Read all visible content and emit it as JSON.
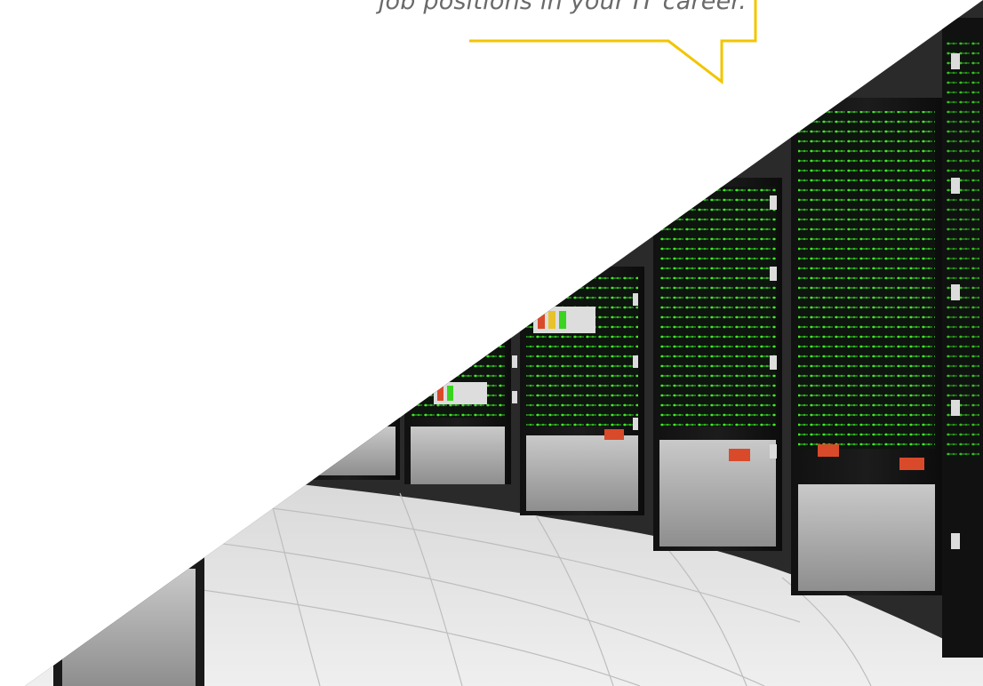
{
  "quote": {
    "text": "job positions in your IT career."
  },
  "colors": {
    "accent": "#f2c500",
    "text": "#6a6a6a",
    "background": "#ffffff",
    "floor": "#e4e4e4",
    "rack": "#1a1a1a",
    "led": "#39d41f"
  },
  "image": {
    "icon": "server-room-photo"
  }
}
